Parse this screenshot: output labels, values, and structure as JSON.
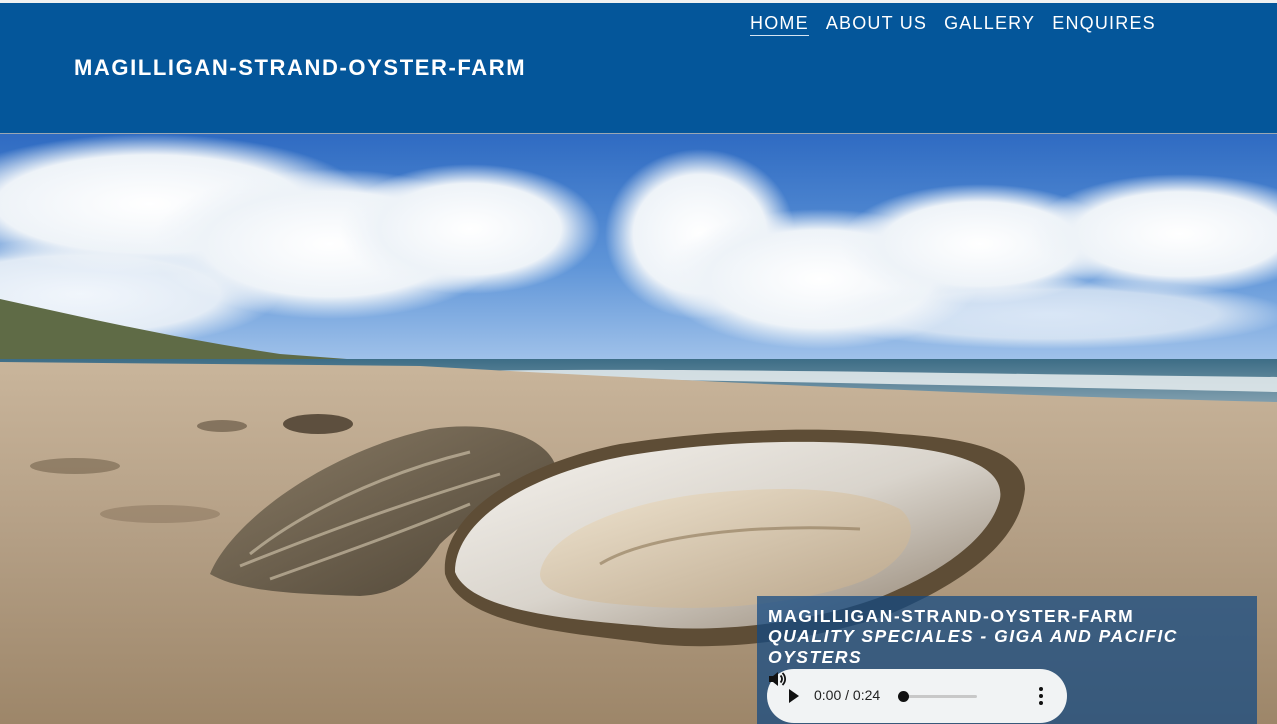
{
  "header": {
    "site_title": "MAGILLIGAN-STRAND-OYSTER-FARM",
    "nav": [
      {
        "label": "HOME",
        "active": true
      },
      {
        "label": "ABOUT US",
        "active": false
      },
      {
        "label": "GALLERY",
        "active": false
      },
      {
        "label": "ENQUIRES",
        "active": false
      }
    ]
  },
  "hero": {
    "caption_title": "MAGILLIGAN-STRAND-OYSTER-FARM",
    "caption_subtitle": "QUALITY SPECIALES - GIGA AND PACIFIC OYSTERS",
    "audio": {
      "time": "0:00 / 0:24",
      "progress": 0,
      "icons": [
        "play-icon",
        "volume-icon",
        "more-options-icon"
      ]
    }
  },
  "colors": {
    "header_bg": "#04569a",
    "caption_bg": "rgba(16,72,130,0.72)",
    "player_bg": "#f1f3f4",
    "text": "#ffffff"
  }
}
